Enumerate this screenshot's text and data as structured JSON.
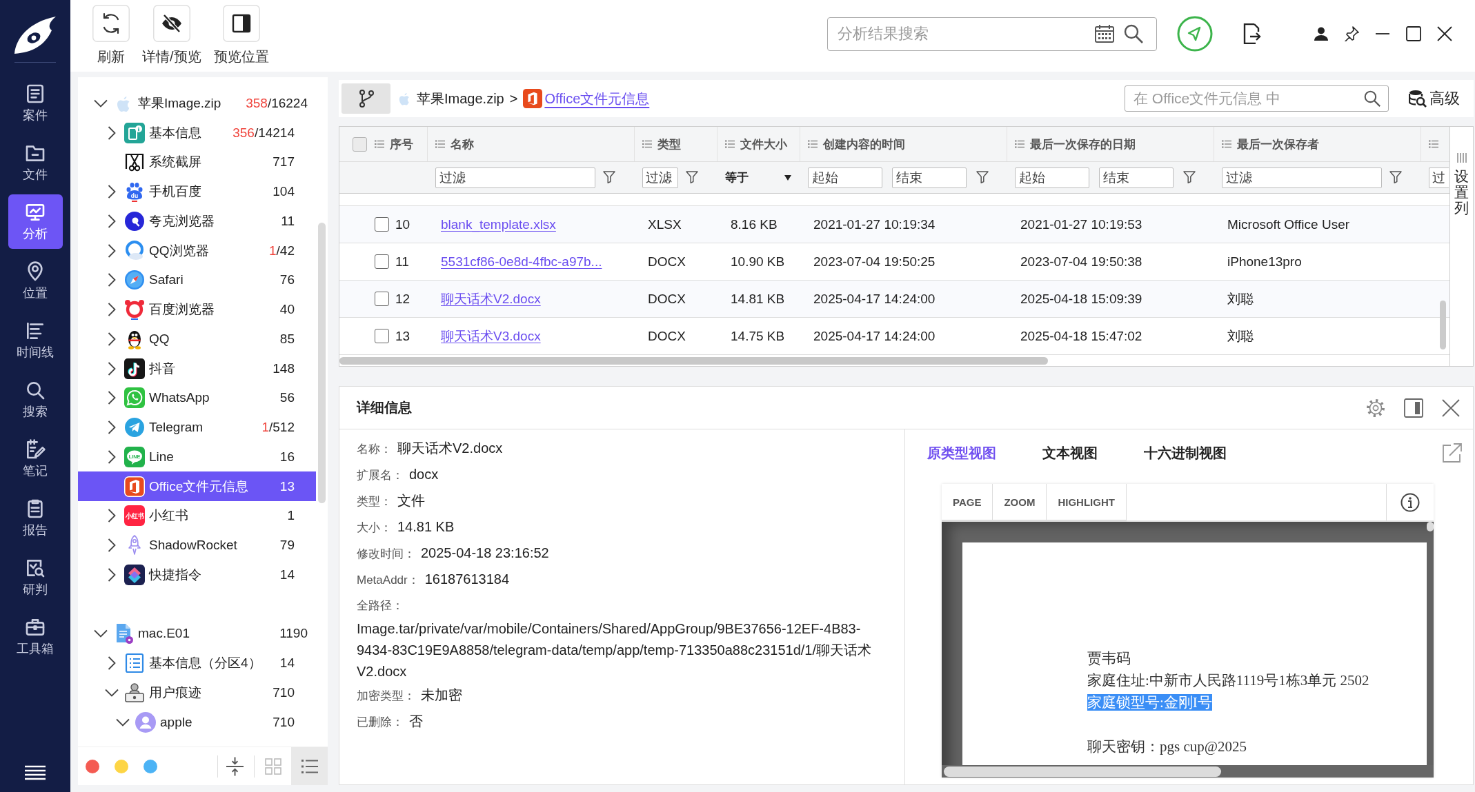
{
  "nav": {
    "items": [
      {
        "kind": "case",
        "label": "案件",
        "selected": false
      },
      {
        "kind": "folder",
        "label": "文件",
        "selected": false
      },
      {
        "kind": "analysis",
        "label": "分析",
        "selected": true
      },
      {
        "kind": "location",
        "label": "位置",
        "selected": false
      },
      {
        "kind": "timeline",
        "label": "时间线",
        "selected": false
      },
      {
        "kind": "search",
        "label": "搜索",
        "selected": false
      },
      {
        "kind": "note",
        "label": "笔记",
        "selected": false
      },
      {
        "kind": "report",
        "label": "报告",
        "selected": false
      },
      {
        "kind": "judge",
        "label": "研判",
        "selected": false
      },
      {
        "kind": "toolbox",
        "label": "工具箱",
        "selected": false
      }
    ]
  },
  "toolbar": {
    "buttons": [
      {
        "kind": "refresh",
        "label": "刷新"
      },
      {
        "kind": "hide",
        "label": "详情/预览"
      },
      {
        "kind": "panel",
        "label": "预览位置"
      }
    ],
    "search": {
      "placeholder": "分析结果搜索"
    }
  },
  "tree": {
    "roots": [
      {
        "kind": "apple",
        "label": "苹果Image.zip",
        "alert": "358",
        "count": "/16224",
        "expanded": true,
        "selected": false,
        "children": [
          {
            "kind": "info",
            "label": "基本信息",
            "alert": "356",
            "count": "/14214",
            "expanded": false,
            "selected": false
          },
          {
            "kind": "screenshot",
            "label": "系统截屏",
            "count": "717",
            "selected": false
          },
          {
            "kind": "paw",
            "label": "手机百度",
            "count": "104",
            "logo_text": "du",
            "expanded": false,
            "selected": false
          },
          {
            "kind": "quark",
            "label": "夸克浏览器",
            "count": "11",
            "expanded": false,
            "selected": false
          },
          {
            "kind": "cloudring",
            "label": "QQ浏览器",
            "alert": "1",
            "count": "/42",
            "expanded": false,
            "selected": false
          },
          {
            "kind": "compass",
            "label": "Safari",
            "count": "76",
            "expanded": false,
            "selected": false
          },
          {
            "kind": "bear",
            "label": "百度浏览器",
            "count": "40",
            "expanded": false,
            "selected": false
          },
          {
            "kind": "penguin",
            "label": "QQ",
            "count": "85",
            "expanded": false,
            "selected": false
          },
          {
            "kind": "note",
            "label": "抖音",
            "count": "148",
            "expanded": false,
            "selected": false
          },
          {
            "kind": "phonebubble",
            "label": "WhatsApp",
            "count": "56",
            "expanded": false,
            "selected": false
          },
          {
            "kind": "plane",
            "label": "Telegram",
            "alert": "1",
            "count": "/512",
            "expanded": false,
            "selected": false
          },
          {
            "kind": "linebubble",
            "label": "Line",
            "count": "16",
            "logo_text": "LINE",
            "expanded": false,
            "selected": false
          },
          {
            "kind": "office",
            "label": "Office文件元信息",
            "count": "13",
            "selected": true
          },
          {
            "kind": "redtile",
            "label": "小红书",
            "count": "1",
            "logo_text": "小红书",
            "expanded": false,
            "selected": false
          },
          {
            "kind": "rocket",
            "label": "ShadowRocket",
            "count": "79",
            "expanded": false,
            "selected": false
          },
          {
            "kind": "layers",
            "label": "快捷指令",
            "count": "14",
            "expanded": false,
            "selected": false
          }
        ]
      },
      {
        "kind": "diskfile",
        "label": "mac.E01",
        "count": "1190",
        "expanded": true,
        "selected": false,
        "children": [
          {
            "kind": "list",
            "label": "基本信息（分区4）",
            "count": "14",
            "expanded": false,
            "selected": false
          },
          {
            "kind": "laptop",
            "label": "用户痕迹",
            "count": "710",
            "expanded": true,
            "selected": false,
            "children": [
              {
                "kind": "user",
                "label": "apple",
                "count": "710",
                "expanded": true,
                "selected": false
              }
            ]
          }
        ]
      }
    ]
  },
  "tree_footer": {
    "color_tags": [
      {
        "color": "#f45b52"
      },
      {
        "color": "#fdd545"
      },
      {
        "color": "#4cb3f5"
      }
    ],
    "view_modes": [
      {
        "kind": "grid",
        "selected": false
      },
      {
        "kind": "list",
        "selected": true
      }
    ]
  },
  "breadcrumb": {
    "separator": ">",
    "items": [
      {
        "kind": "apple",
        "label": "苹果Image.zip",
        "current": false
      },
      {
        "kind": "office",
        "label": "Office文件元信息",
        "current": true
      }
    ],
    "search": {
      "placeholder": "在 Office文件元信息 中"
    },
    "advanced": {
      "label": "高级"
    }
  },
  "table": {
    "select_all": {
      "checked": false
    },
    "columns": [
      {
        "label": "序号"
      },
      {
        "label": "名称",
        "filter": {
          "kind": "text",
          "placeholder": "过滤"
        }
      },
      {
        "label": "类型",
        "filter": {
          "kind": "text",
          "placeholder": "过滤"
        }
      },
      {
        "label": "文件大小",
        "filter": {
          "kind": "select",
          "value": "等于"
        }
      },
      {
        "label": "创建内容的时间",
        "filter": {
          "kind": "range",
          "from": {
            "placeholder": "起始"
          },
          "to": {
            "placeholder": "结束"
          }
        }
      },
      {
        "label": "最后一次保存的日期",
        "filter": {
          "kind": "range",
          "from": {
            "placeholder": "起始"
          },
          "to": {
            "placeholder": "结束"
          }
        }
      },
      {
        "label": "最后一次保存者",
        "filter": {
          "kind": "text",
          "placeholder": "过滤"
        }
      },
      {
        "filter": {
          "kind": "text",
          "placeholder": "过"
        }
      }
    ],
    "rows": [
      {
        "checked": false,
        "seq": "10",
        "name": "blank_template.xlsx",
        "type": "XLSX",
        "size": "8.16 KB",
        "created": "2021-01-27 10:19:34",
        "saved": "2021-01-27 10:19:53",
        "saver": "Microsoft Office User"
      },
      {
        "checked": false,
        "seq": "11",
        "name": "5531cf86-0e8d-4fbc-a97b...",
        "type": "DOCX",
        "size": "10.90 KB",
        "created": "2023-07-04 19:50:25",
        "saved": "2023-07-04 19:50:38",
        "saver": "iPhone13pro"
      },
      {
        "checked": false,
        "seq": "12",
        "name": "聊天话术V2.docx",
        "type": "DOCX",
        "size": "14.81 KB",
        "created": "2025-04-17 14:24:00",
        "saved": "2025-04-18 15:09:39",
        "saver": "刘聪"
      },
      {
        "checked": false,
        "seq": "13",
        "name": "聊天话术V3.docx",
        "type": "DOCX",
        "size": "14.75 KB",
        "created": "2025-04-17 14:24:00",
        "saved": "2025-04-18 15:47:02",
        "saver": "刘聪"
      }
    ],
    "column_settings": {
      "label": "设置列"
    }
  },
  "details": {
    "title": "详细信息",
    "fields": [
      {
        "kind": "inline",
        "label": "名称：",
        "value": "聊天话术V2.docx"
      },
      {
        "kind": "inline",
        "label": "扩展名：",
        "value": "docx"
      },
      {
        "kind": "inline",
        "label": "类型：",
        "value": "文件"
      },
      {
        "kind": "inline",
        "label": "大小：",
        "value": "14.81 KB"
      },
      {
        "kind": "inline",
        "label": "修改时间：",
        "value": "2025-04-18 23:16:52"
      },
      {
        "kind": "inline",
        "label": "MetaAddr：",
        "value": "16187613184"
      },
      {
        "kind": "block",
        "label": "全路径：",
        "value": "Image.tar/private/var/mobile/Containers/Shared/AppGroup/9BE37656-12EF-4B83-9434-83C19E9A8858/telegram-data/temp/app/temp-713350a88c23151d/1/聊天话术V2.docx"
      },
      {
        "kind": "inline",
        "label": "加密类型：",
        "value": "未加密"
      },
      {
        "kind": "inline",
        "label": "已删除：",
        "value": "否"
      }
    ],
    "views": [
      {
        "label": "原类型视图",
        "selected": true
      },
      {
        "label": "文本视图",
        "selected": false
      },
      {
        "label": "十六进制视图",
        "selected": false
      }
    ],
    "viewer": {
      "buttons": [
        {
          "label": "PAGE"
        },
        {
          "label": "ZOOM"
        },
        {
          "label": "HIGHLIGHT"
        }
      ],
      "paragraphs": [
        {
          "lines": [
            {
              "text": "贾韦码",
              "highlighted": false
            },
            {
              "text": "家庭住址:中新市人民路1119号1栋3单元 2502",
              "highlighted": false
            },
            {
              "text": "家庭锁型号:金刚I号",
              "highlighted": true
            }
          ]
        },
        {
          "lines": [
            {
              "text": "聊天密钥：pgs cup@2025",
              "highlighted": false
            }
          ]
        }
      ]
    }
  }
}
